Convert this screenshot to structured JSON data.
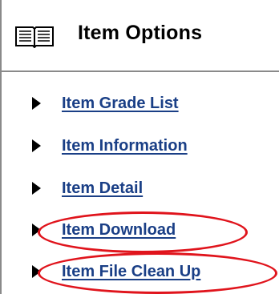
{
  "panel": {
    "title": "Item Options",
    "title_icon": "open-book-icon"
  },
  "menu": {
    "items": [
      {
        "label": "Item Grade List",
        "icon": "triangle-arrow-right-icon"
      },
      {
        "label": "Item Information",
        "icon": "triangle-arrow-right-icon"
      },
      {
        "label": "Item Detail",
        "icon": "triangle-arrow-right-icon"
      },
      {
        "label": "Item Download",
        "icon": "triangle-arrow-right-icon",
        "highlighted": true
      },
      {
        "label": "Item File Clean Up",
        "icon": "triangle-arrow-right-icon",
        "highlighted": true
      }
    ]
  },
  "colors": {
    "link": "#1a3f86",
    "highlight": "#e0141c",
    "border": "#8a8a8a"
  }
}
